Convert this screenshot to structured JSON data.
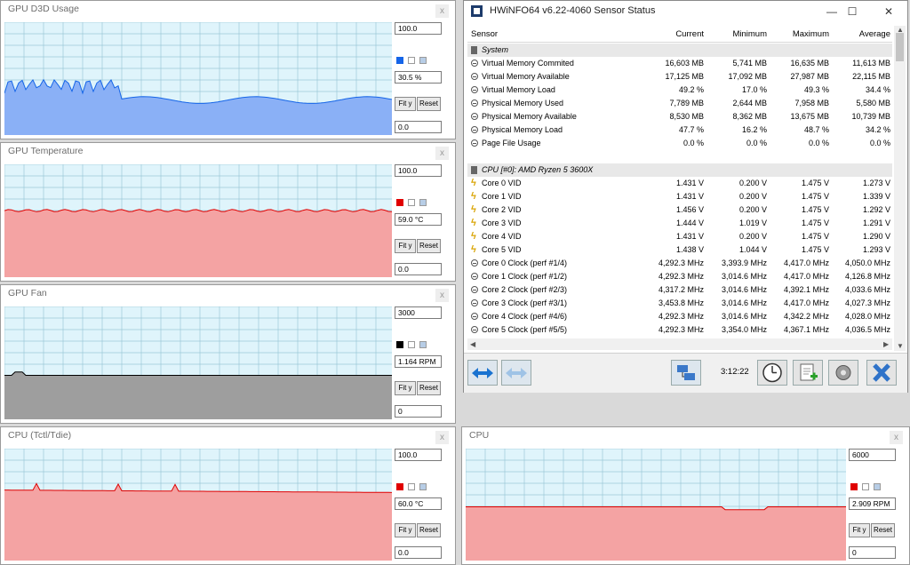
{
  "graphs": [
    {
      "title": "GPU D3D Usage",
      "max": "100.0",
      "value": "30.5 %",
      "min": "0.0",
      "color": "#1565e8",
      "fill": "#8ab0f6",
      "fit_label": "Fit y",
      "reset_label": "Reset",
      "level": 0.31
    },
    {
      "title": "GPU Temperature",
      "max": "100.0",
      "value": "59.0 °C",
      "min": "0.0",
      "color": "#e00000",
      "fill": "#f4a3a3",
      "fit_label": "Fit y",
      "reset_label": "Reset",
      "level": 0.59
    },
    {
      "title": "GPU Fan",
      "max": "3000",
      "value": "1.164 RPM",
      "min": "0",
      "color": "#000000",
      "fill": "#9e9e9e",
      "fit_label": "Fit y",
      "reset_label": "Reset",
      "level": 0.39
    },
    {
      "title": "CPU (Tctl/Tdie)",
      "max": "100.0",
      "value": "60.0 °C",
      "min": "0.0",
      "color": "#e00000",
      "fill": "#f4a3a3",
      "fit_label": "Fit y",
      "reset_label": "Reset",
      "level": 0.6
    },
    {
      "title": "CPU",
      "max": "6000",
      "value": "2.909 RPM",
      "min": "0",
      "color": "#e00000",
      "fill": "#f4a3a3",
      "fit_label": "Fit y",
      "reset_label": "Reset",
      "level": 0.48
    }
  ],
  "sensor_window": {
    "title": "HWiNFO64 v6.22-4060 Sensor Status",
    "columns": [
      "Sensor",
      "Current",
      "Minimum",
      "Maximum",
      "Average"
    ],
    "rows": [
      {
        "kind": "group",
        "icon": "chip-icon",
        "name": "System"
      },
      {
        "kind": "data",
        "icon": "clock-icon",
        "name": "Virtual Memory Commited",
        "cur": "16,603 MB",
        "min": "5,741 MB",
        "max": "16,635 MB",
        "avg": "11,613 MB"
      },
      {
        "kind": "data",
        "icon": "clock-icon",
        "name": "Virtual Memory Available",
        "cur": "17,125 MB",
        "min": "17,092 MB",
        "max": "27,987 MB",
        "avg": "22,115 MB"
      },
      {
        "kind": "data",
        "icon": "clock-icon",
        "name": "Virtual Memory Load",
        "cur": "49.2 %",
        "min": "17.0 %",
        "max": "49.3 %",
        "avg": "34.4 %"
      },
      {
        "kind": "data",
        "icon": "clock-icon",
        "name": "Physical Memory Used",
        "cur": "7,789 MB",
        "min": "2,644 MB",
        "max": "7,958 MB",
        "avg": "5,580 MB"
      },
      {
        "kind": "data",
        "icon": "clock-icon",
        "name": "Physical Memory Available",
        "cur": "8,530 MB",
        "min": "8,362 MB",
        "max": "13,675 MB",
        "avg": "10,739 MB"
      },
      {
        "kind": "data",
        "icon": "clock-icon",
        "name": "Physical Memory Load",
        "cur": "47.7 %",
        "min": "16.2 %",
        "max": "48.7 %",
        "avg": "34.2 %"
      },
      {
        "kind": "data",
        "icon": "clock-icon",
        "name": "Page File Usage",
        "cur": "0.0 %",
        "min": "0.0 %",
        "max": "0.0 %",
        "avg": "0.0 %"
      },
      {
        "kind": "blank"
      },
      {
        "kind": "group",
        "icon": "chip-icon",
        "name": "CPU [#0]: AMD Ryzen 5 3600X"
      },
      {
        "kind": "data",
        "icon": "volt-icon",
        "name": "Core 0 VID",
        "cur": "1.431 V",
        "min": "0.200 V",
        "max": "1.475 V",
        "avg": "1.273 V"
      },
      {
        "kind": "data",
        "icon": "volt-icon",
        "name": "Core 1 VID",
        "cur": "1.431 V",
        "min": "0.200 V",
        "max": "1.475 V",
        "avg": "1.339 V"
      },
      {
        "kind": "data",
        "icon": "volt-icon",
        "name": "Core 2 VID",
        "cur": "1.456 V",
        "min": "0.200 V",
        "max": "1.475 V",
        "avg": "1.292 V"
      },
      {
        "kind": "data",
        "icon": "volt-icon",
        "name": "Core 3 VID",
        "cur": "1.444 V",
        "min": "1.019 V",
        "max": "1.475 V",
        "avg": "1.291 V"
      },
      {
        "kind": "data",
        "icon": "volt-icon",
        "name": "Core 4 VID",
        "cur": "1.431 V",
        "min": "0.200 V",
        "max": "1.475 V",
        "avg": "1.290 V"
      },
      {
        "kind": "data",
        "icon": "volt-icon",
        "name": "Core 5 VID",
        "cur": "1.438 V",
        "min": "1.044 V",
        "max": "1.475 V",
        "avg": "1.293 V"
      },
      {
        "kind": "data",
        "icon": "clock-icon",
        "name": "Core 0 Clock (perf #1/4)",
        "cur": "4,292.3 MHz",
        "min": "3,393.9 MHz",
        "max": "4,417.0 MHz",
        "avg": "4,050.0 MHz"
      },
      {
        "kind": "data",
        "icon": "clock-icon",
        "name": "Core 1 Clock (perf #1/2)",
        "cur": "4,292.3 MHz",
        "min": "3,014.6 MHz",
        "max": "4,417.0 MHz",
        "avg": "4,126.8 MHz"
      },
      {
        "kind": "data",
        "icon": "clock-icon",
        "name": "Core 2 Clock (perf #2/3)",
        "cur": "4,317.2 MHz",
        "min": "3,014.6 MHz",
        "max": "4,392.1 MHz",
        "avg": "4,033.6 MHz"
      },
      {
        "kind": "data",
        "icon": "clock-icon",
        "name": "Core 3 Clock (perf #3/1)",
        "cur": "3,453.8 MHz",
        "min": "3,014.6 MHz",
        "max": "4,417.0 MHz",
        "avg": "4,027.3 MHz"
      },
      {
        "kind": "data",
        "icon": "clock-icon",
        "name": "Core 4 Clock (perf #4/6)",
        "cur": "4,292.3 MHz",
        "min": "3,014.6 MHz",
        "max": "4,342.2 MHz",
        "avg": "4,028.0 MHz"
      },
      {
        "kind": "data",
        "icon": "clock-icon",
        "name": "Core 5 Clock (perf #5/5)",
        "cur": "4,292.3 MHz",
        "min": "3,354.0 MHz",
        "max": "4,367.1 MHz",
        "avg": "4,036.5 MHz"
      }
    ],
    "elapsed": "3:12:22"
  }
}
